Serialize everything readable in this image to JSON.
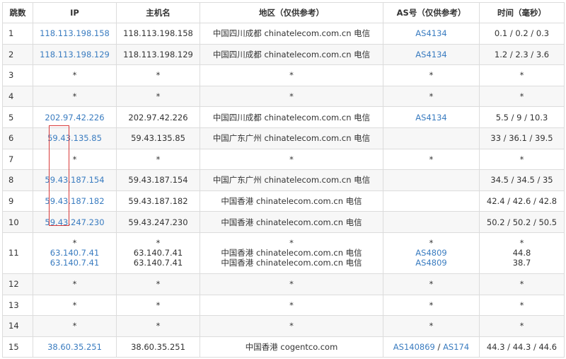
{
  "headers": {
    "hop": "跳数",
    "ip": "IP",
    "host": "主机名",
    "region": "地区（仅供参考）",
    "as": "AS号（仅供参考）",
    "time": "时间（毫秒）"
  },
  "rows": [
    {
      "hop": "1",
      "ip": "118.113.198.158",
      "host": "118.113.198.158",
      "region": "中国四川成都 chinatelecom.com.cn 电信",
      "as": "AS4134",
      "time": "0.1 / 0.2 / 0.3"
    },
    {
      "hop": "2",
      "ip": "118.113.198.129",
      "host": "118.113.198.129",
      "region": "中国四川成都 chinatelecom.com.cn 电信",
      "as": "AS4134",
      "time": "1.2 / 2.3 / 3.6"
    },
    {
      "hop": "3",
      "ip": "*",
      "host": "*",
      "region": "*",
      "as": "*",
      "time": "*"
    },
    {
      "hop": "4",
      "ip": "*",
      "host": "*",
      "region": "*",
      "as": "*",
      "time": "*"
    },
    {
      "hop": "5",
      "ip": "202.97.42.226",
      "host": "202.97.42.226",
      "region": "中国四川成都 chinatelecom.com.cn 电信",
      "as": "AS4134",
      "time": "5.5 / 9 / 10.3"
    },
    {
      "hop": "6",
      "ip": "59.43.135.85",
      "host": "59.43.135.85",
      "region": "中国广东广州 chinatelecom.com.cn 电信",
      "as": "",
      "time": "33 / 36.1 / 39.5"
    },
    {
      "hop": "7",
      "ip": "*",
      "host": "*",
      "region": "*",
      "as": "*",
      "time": "*"
    },
    {
      "hop": "8",
      "ip": "59.43.187.154",
      "host": "59.43.187.154",
      "region": "中国广东广州 chinatelecom.com.cn 电信",
      "as": "",
      "time": "34.5 / 34.5 / 35"
    },
    {
      "hop": "9",
      "ip": "59.43.187.182",
      "host": "59.43.187.182",
      "region": "中国香港 chinatelecom.com.cn 电信",
      "as": "",
      "time": "42.4 / 42.6 / 42.8"
    },
    {
      "hop": "10",
      "ip": "59.43.247.230",
      "host": "59.43.247.230",
      "region": "中国香港 chinatelecom.com.cn 电信",
      "as": "",
      "time": "50.2 / 50.2 / 50.5"
    },
    {
      "hop": "11",
      "multi": true,
      "ip": [
        "*",
        "63.140.7.41",
        "63.140.7.41"
      ],
      "host": [
        "*",
        "63.140.7.41",
        "63.140.7.41"
      ],
      "region": [
        "*",
        "中国香港 chinatelecom.com.cn 电信",
        "中国香港 chinatelecom.com.cn 电信"
      ],
      "as": [
        "*",
        "AS4809",
        "AS4809"
      ],
      "time": [
        "*",
        "44.8",
        "38.7"
      ]
    },
    {
      "hop": "12",
      "ip": "*",
      "host": "*",
      "region": "*",
      "as": "*",
      "time": "*"
    },
    {
      "hop": "13",
      "ip": "*",
      "host": "*",
      "region": "*",
      "as": "*",
      "time": "*"
    },
    {
      "hop": "14",
      "ip": "*",
      "host": "*",
      "region": "*",
      "as": "*",
      "time": "*"
    },
    {
      "hop": "15",
      "ip": "38.60.35.251",
      "host": "38.60.35.251",
      "region": "中国香港 cogentco.com",
      "as": [
        "AS140869",
        "AS174"
      ],
      "as_separator": " / ",
      "time": "44.3 / 44.3 / 44.6"
    }
  ],
  "colors": {
    "link": "#3a7cc0",
    "border": "#dcdcdc",
    "alt_row": "#f7f7f7",
    "highlight": "#d93a3a"
  }
}
